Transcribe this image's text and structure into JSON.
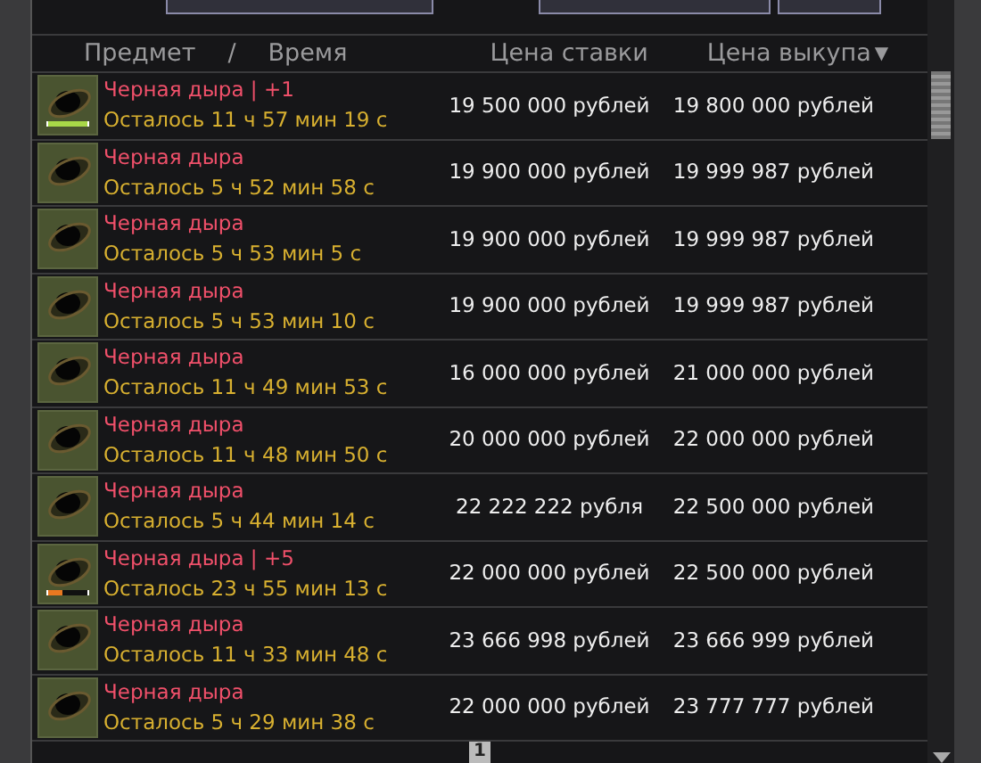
{
  "columns": [
    {
      "label": "Предмет"
    },
    {
      "label": "/"
    },
    {
      "label": "Время"
    },
    {
      "label": "Цена ставки"
    },
    {
      "label": "Цена выкупа",
      "sort_arrow": "▼"
    }
  ],
  "rows": [
    {
      "name": "Черная дыра | +1",
      "time": "Осталось 11 ч 57 мин 19 с",
      "bid": "19 500 000 рублей",
      "buyout": "19 800 000 рублей",
      "enhance": {
        "level": 1,
        "color": "#a8d848"
      }
    },
    {
      "name": "Черная дыра",
      "time": "Осталось 5 ч 52 мин 58 с",
      "bid": "19 900 000 рублей",
      "buyout": "19 999 987 рублей"
    },
    {
      "name": "Черная дыра",
      "time": "Осталось 5 ч 53 мин 5 с",
      "bid": "19 900 000 рублей",
      "buyout": "19 999 987 рублей"
    },
    {
      "name": "Черная дыра",
      "time": "Осталось 5 ч 53 мин 10 с",
      "bid": "19 900 000 рублей",
      "buyout": "19 999 987 рублей"
    },
    {
      "name": "Черная дыра",
      "time": "Осталось 11 ч 49 мин 53 с",
      "bid": "16 000 000 рублей",
      "buyout": "21 000 000 рублей"
    },
    {
      "name": "Черная дыра",
      "time": "Осталось 11 ч 48 мин 50 с",
      "bid": "20 000 000 рублей",
      "buyout": "22 000 000 рублей"
    },
    {
      "name": "Черная дыра",
      "time": "Осталось 5 ч 44 мин 14 с",
      "bid": "22 222 222 рубля",
      "buyout": "22 500 000 рублей"
    },
    {
      "name": "Черная дыра | +5",
      "time": "Осталось 23 ч 55 мин 13 с",
      "bid": "22 000 000 рублей",
      "buyout": "22 500 000 рублей",
      "enhance": {
        "level": 0.35,
        "color": "#e87820"
      }
    },
    {
      "name": "Черная дыра",
      "time": "Осталось 11 ч 33 мин 48 с",
      "bid": "23 666 998 рублей",
      "buyout": "23 666 999 рублей"
    },
    {
      "name": "Черная дыра",
      "time": "Осталось 5 ч 29 мин 38 с",
      "bid": "22 000 000 рублей",
      "buyout": "23 777 777 рублей"
    }
  ],
  "pagination": [
    {
      "label": "1",
      "selected": true
    }
  ]
}
